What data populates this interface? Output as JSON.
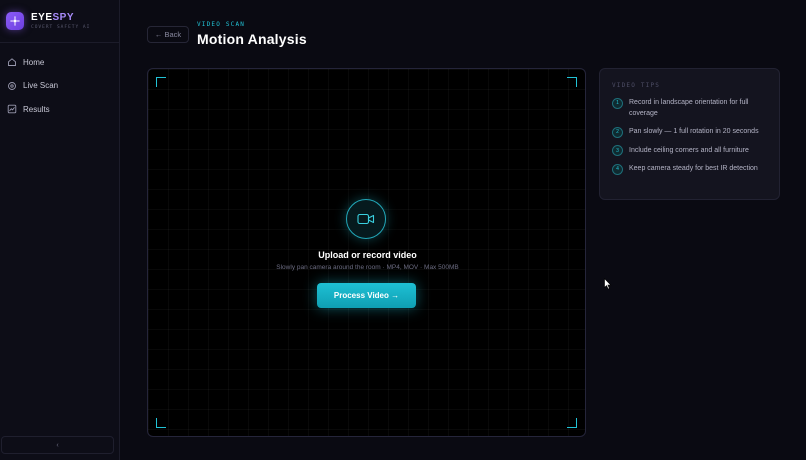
{
  "brand": {
    "name_part1": "EYE",
    "name_part2": "SPY",
    "tagline": "COVERT SAFETY AI"
  },
  "sidebar": {
    "items": [
      {
        "label": "Home",
        "icon": "home-icon"
      },
      {
        "label": "Live Scan",
        "icon": "scan-icon"
      },
      {
        "label": "Results",
        "icon": "chart-icon"
      }
    ],
    "collapse_label": "‹"
  },
  "header": {
    "back_label": "← Back",
    "eyebrow": "VIDEO SCAN",
    "title": "Motion Analysis"
  },
  "scan": {
    "title": "Upload or record video",
    "subtitle": "Slowly pan camera around the room · MP4, MOV · Max 500MB",
    "button_label": "Process Video →"
  },
  "tips": {
    "title": "VIDEO TIPS",
    "items": [
      {
        "num": "1",
        "text": "Record in landscape orientation for full coverage"
      },
      {
        "num": "2",
        "text": "Pan slowly — 1 full rotation in 20 seconds"
      },
      {
        "num": "3",
        "text": "Include ceiling corners and all furniture"
      },
      {
        "num": "4",
        "text": "Keep camera steady for best IR detection"
      }
    ]
  },
  "colors": {
    "accent_cyan": "#22c3d6",
    "brand_purple": "#8b5cf6",
    "background": "#0a0a12"
  }
}
